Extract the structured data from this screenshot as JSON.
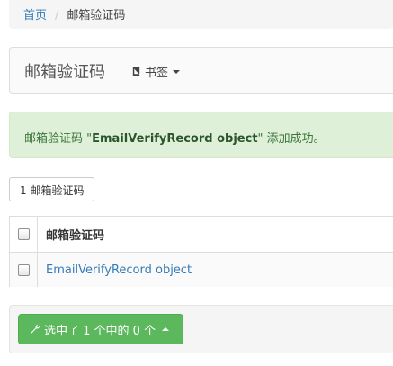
{
  "breadcrumb": {
    "home": "首页",
    "separator": "/",
    "current": "邮箱验证码"
  },
  "header": {
    "title": "邮箱验证码",
    "bookmark_label": "书签",
    "bookmark_icon": "book-icon"
  },
  "alert": {
    "prefix": "邮箱验证码 \"",
    "object_name": "EmailVerifyRecord object",
    "suffix": "\" 添加成功。"
  },
  "count_button": {
    "label": "1 邮箱验证码"
  },
  "table": {
    "column_header": "邮箱验证码",
    "rows": [
      {
        "label": "EmailVerifyRecord object"
      }
    ]
  },
  "actions": {
    "label": "选中了 1 个中的 0 个",
    "icon": "wrench-icon"
  },
  "colors": {
    "link": "#337ab7",
    "success_bg": "#dff0d8",
    "success_text": "#3c763d",
    "action_button": "#5cb85c"
  }
}
